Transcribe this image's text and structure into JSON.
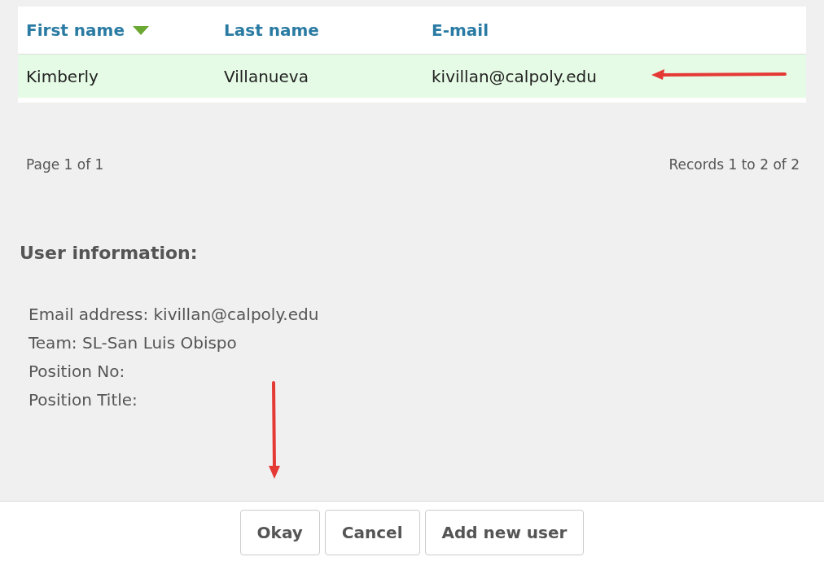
{
  "table": {
    "columns": [
      {
        "label": "First name",
        "sorted": true
      },
      {
        "label": "Last name",
        "sorted": false
      },
      {
        "label": "E-mail",
        "sorted": false
      }
    ],
    "rows": [
      {
        "cells": [
          "Kimberly",
          "Villanueva",
          "kivillan@calpoly.edu"
        ],
        "selected": true
      }
    ]
  },
  "pager": {
    "page": "Page 1 of 1",
    "records": "Records 1 to 2 of 2"
  },
  "user_information": {
    "heading": "User information:",
    "lines": [
      "Email address: kivillan@calpoly.edu",
      "Team: SL-San Luis Obispo",
      "Position No:",
      "Position Title:"
    ]
  },
  "buttons": [
    "Okay",
    "Cancel",
    "Add new user"
  ]
}
